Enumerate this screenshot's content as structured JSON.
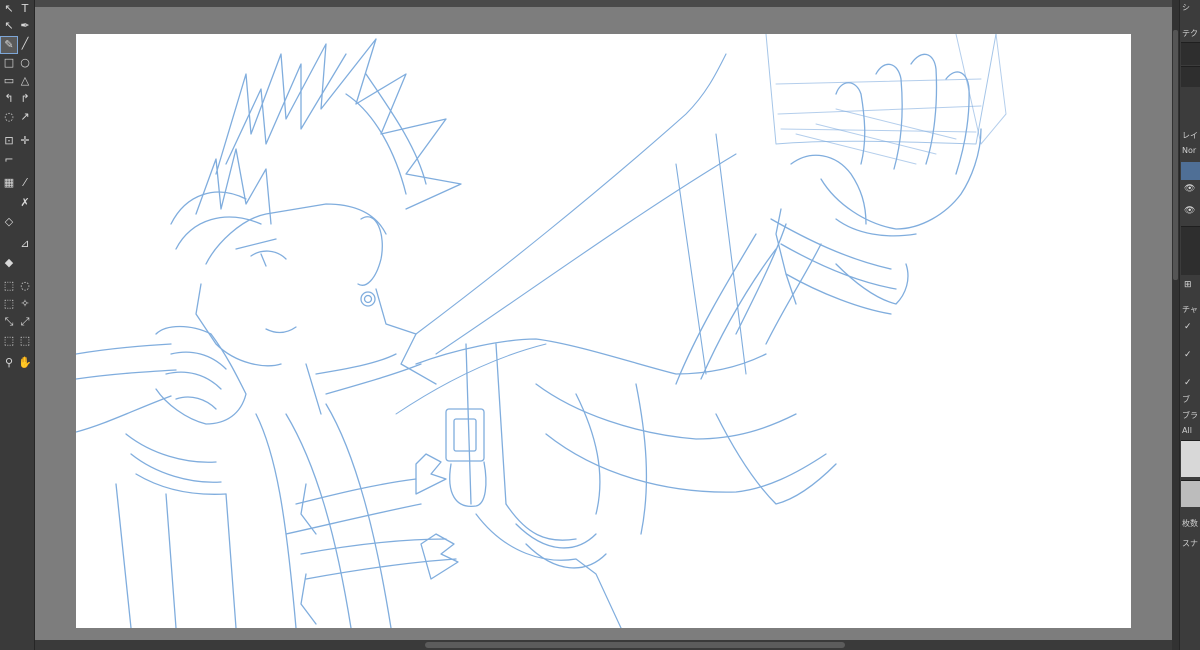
{
  "toolbar": {
    "tools": [
      {
        "name": "move-icon",
        "glyph": "↖"
      },
      {
        "name": "text-tool-icon",
        "glyph": "T"
      },
      {
        "name": "select-arrow-icon",
        "glyph": "↖"
      },
      {
        "name": "pen-nib-icon",
        "glyph": "✒"
      },
      {
        "name": "pencil-icon",
        "glyph": "✎",
        "active": true
      },
      {
        "name": "line-icon",
        "glyph": "╱"
      },
      {
        "name": "rectangle-icon",
        "glyph": "□"
      },
      {
        "name": "ellipse-icon",
        "glyph": "○"
      },
      {
        "name": "frame-icon",
        "glyph": "▭"
      },
      {
        "name": "polygon-icon",
        "glyph": "△"
      },
      {
        "name": "bezier-icon",
        "glyph": "↰"
      },
      {
        "name": "curve-icon",
        "glyph": "↱"
      },
      {
        "name": "lasso-icon",
        "glyph": "◌"
      },
      {
        "name": "path-icon",
        "glyph": "↗"
      },
      {
        "name": "transform-icon",
        "glyph": "⊡"
      },
      {
        "name": "move-cross-icon",
        "glyph": "✛"
      },
      {
        "name": "crop-icon",
        "glyph": "⌐"
      },
      {
        "name": "gradient-icon",
        "glyph": "▦"
      },
      {
        "name": "eyedropper-icon",
        "glyph": "⁄"
      },
      {
        "name": "blend-icon",
        "glyph": "✗"
      },
      {
        "name": "eraser-icon",
        "glyph": "◇"
      },
      {
        "name": "ruler-icon",
        "glyph": "⊿"
      },
      {
        "name": "fill-icon",
        "glyph": "◆"
      },
      {
        "name": "select-rect-icon",
        "glyph": "⬚"
      },
      {
        "name": "select-ellipse-icon",
        "glyph": "◌"
      },
      {
        "name": "select-lasso-icon",
        "glyph": "⬚"
      },
      {
        "name": "select-magic-icon",
        "glyph": "✧"
      },
      {
        "name": "select-pen-icon",
        "glyph": "⤡"
      },
      {
        "name": "select-erase-icon",
        "glyph": "⤢"
      },
      {
        "name": "select-add-icon",
        "glyph": "⬚"
      },
      {
        "name": "select-sub-icon",
        "glyph": "⬚"
      },
      {
        "name": "zoom-icon",
        "glyph": "⚲"
      },
      {
        "name": "hand-icon",
        "glyph": "✋"
      }
    ]
  },
  "right_panel": {
    "labels": [
      "シ",
      "テク",
      "レイ",
      "Nor",
      "チャ",
      "ブ",
      "ブラ",
      "All",
      "枚数",
      "スナ"
    ],
    "eye_icon": "👁",
    "check_icon": "✓",
    "plus_icon": "⊞"
  },
  "colors": {
    "sketch_stroke": "#6a9fd8",
    "canvas": "#ffffff",
    "workspace": "#7d7d7d",
    "panel": "#3a3a3a"
  }
}
